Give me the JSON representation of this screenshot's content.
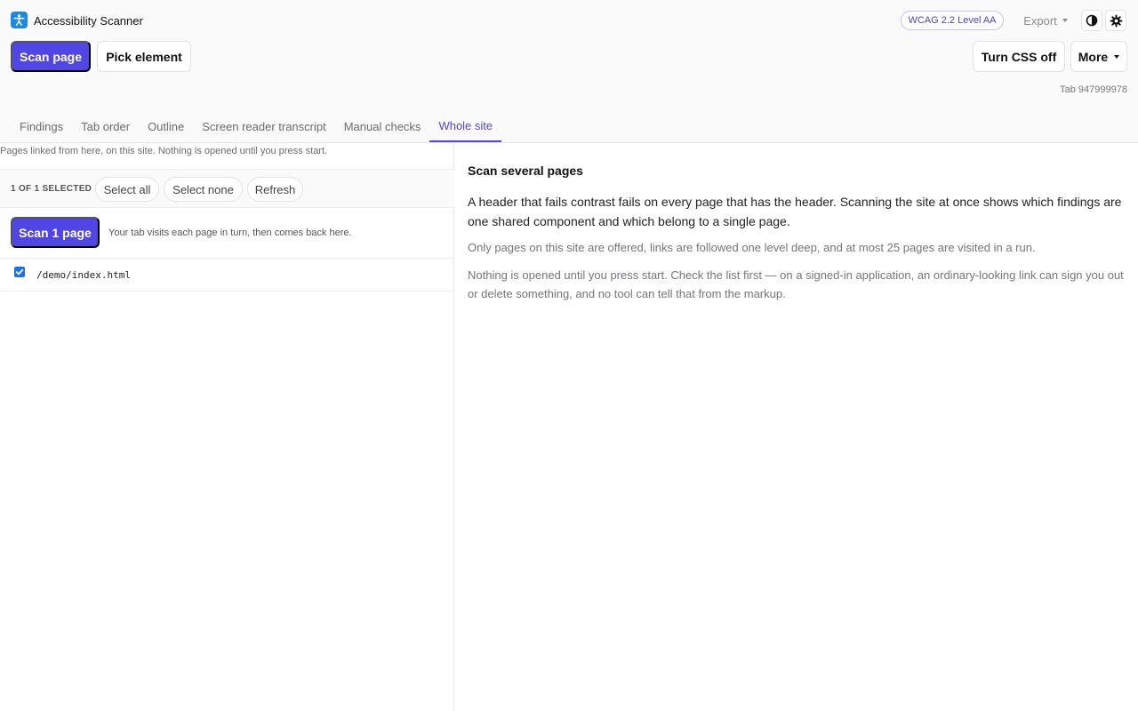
{
  "app": {
    "title": "Accessibility Scanner",
    "logo_icon": "accessibility-person-icon"
  },
  "header": {
    "wcag_badge": "WCAG 2.2 Level AA",
    "export_label": "Export",
    "contrast_icon": "contrast-icon",
    "settings_icon": "gear-icon",
    "scan_page_label": "Scan page",
    "pick_element_label": "Pick element",
    "turn_css_off_label": "Turn CSS off",
    "more_label": "More",
    "tab_id": "Tab 947999978"
  },
  "tabs": [
    {
      "label": "Findings",
      "active": false
    },
    {
      "label": "Tab order",
      "active": false
    },
    {
      "label": "Outline",
      "active": false
    },
    {
      "label": "Screen reader transcript",
      "active": false
    },
    {
      "label": "Manual checks",
      "active": false
    },
    {
      "label": "Whole site",
      "active": true
    }
  ],
  "left": {
    "description": "Pages linked from here, on this site. Nothing is opened until you press start.",
    "selected_count": "1 OF 1 SELECTED",
    "select_all": "Select all",
    "select_none": "Select none",
    "refresh": "Refresh",
    "scan_button": "Scan 1 page",
    "scan_note": "Your tab visits each page in turn, then comes back here.",
    "pages": [
      {
        "path": "/demo/index.html",
        "checked": true
      }
    ]
  },
  "right": {
    "title": "Scan several pages",
    "p1": "A header that fails contrast fails on every page that has the header. Scanning the site at once shows which findings are one shared component and which belong to a single page.",
    "p2": "Only pages on this site are offered, links are followed one level deep, and at most 25 pages are visited in a run.",
    "p3": "Nothing is opened until you press start. Check the list first — on a signed-in application, an ordinary-looking link can sign you out or delete something, and no tool can tell that from the markup."
  },
  "colors": {
    "accent": "#4f46e5",
    "logo": "#1e88e5",
    "checkbox": "#1a73e8"
  }
}
